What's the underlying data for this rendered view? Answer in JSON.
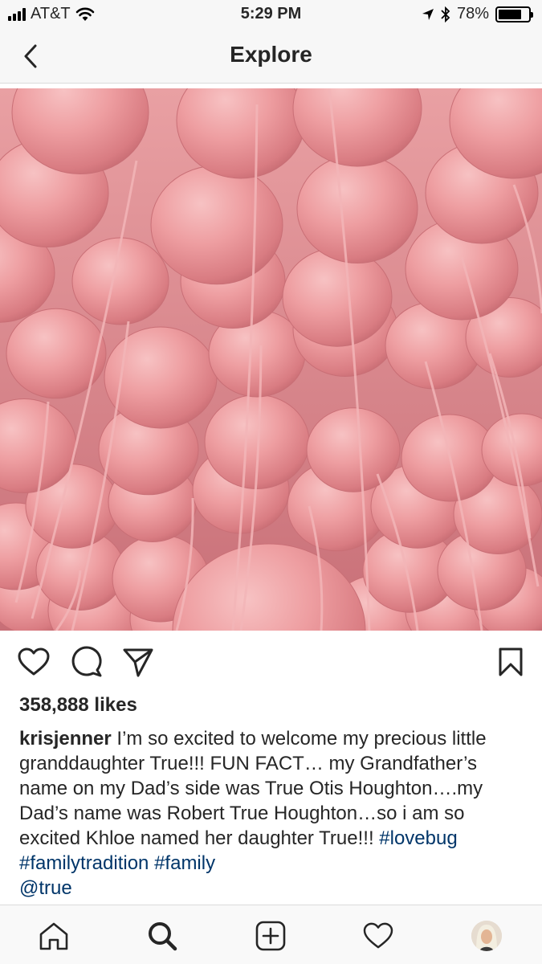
{
  "status_bar": {
    "carrier": "AT&T",
    "time": "5:29 PM",
    "battery": "78%",
    "battery_level": 0.78
  },
  "nav": {
    "title": "Explore",
    "back_icon": "chevron-left-icon"
  },
  "post": {
    "image_subject": "pink balloons",
    "likes": "358,888 likes",
    "username": "krisjenner",
    "caption": " I’m so excited to welcome my precious little granddaughter True!!! FUN FACT… my Grandfather’s name on my Dad’s side was True Otis Houghton….my Dad’s name was Robert True Houghton…so i am so excited Khloe named her daughter True!!! ",
    "hashtags": [
      "#lovebug",
      "#familytradition",
      "#family"
    ],
    "mention": "@true",
    "actions": [
      "heart-icon",
      "comment-icon",
      "share-icon",
      "bookmark-icon"
    ]
  },
  "tabs": [
    "home-icon",
    "search-icon",
    "add-icon",
    "activity-icon",
    "profile-avatar"
  ],
  "colors": {
    "hashtag": "#003569",
    "balloon": "#e8959a"
  }
}
